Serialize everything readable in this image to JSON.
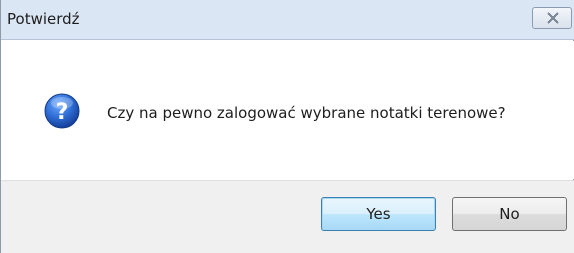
{
  "window": {
    "title": "Potwierdź",
    "close_icon": "close-icon"
  },
  "message": {
    "icon": "question-icon",
    "text": "Czy na pewno zalogować wybrane notatki terenowe?"
  },
  "buttons": {
    "yes_label": "Yes",
    "no_label": "No"
  },
  "colors": {
    "titlebar": "#dbe6f4",
    "footer": "#f0f0f0",
    "icon_blue": "#1f5fbf",
    "default_button_border": "#3c7fb1"
  }
}
